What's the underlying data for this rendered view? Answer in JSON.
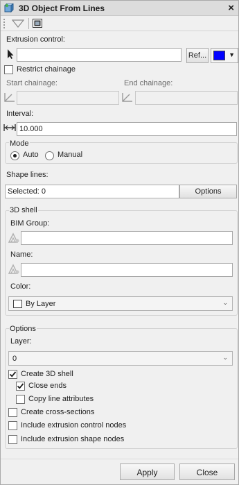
{
  "window": {
    "title": "3D Object From Lines",
    "close_glyph": "×"
  },
  "extrusion": {
    "label": "Extrusion control:",
    "value": "",
    "ref_button": "Ref...",
    "color": "#0000ff",
    "dropdown_glyph": "▼"
  },
  "restrict": {
    "label": "Restrict chainage",
    "checked": false
  },
  "chainage": {
    "start_label": "Start chainage:",
    "end_label": "End chainage:",
    "start_value": "",
    "end_value": ""
  },
  "interval": {
    "label": "Interval:",
    "value": "10.000"
  },
  "mode": {
    "label": "Mode",
    "options": [
      "Auto",
      "Manual"
    ],
    "selected": "Auto"
  },
  "shape_lines": {
    "label": "Shape lines:",
    "value": "Selected: 0",
    "options_button": "Options"
  },
  "shell": {
    "group_label": "3D shell",
    "bim_label": "BIM Group:",
    "bim_value": "",
    "name_label": "Name:",
    "name_value": "",
    "color_label": "Color:",
    "color_value": "By Layer",
    "dropdown_glyph": "⌄"
  },
  "options": {
    "group_label": "Options",
    "layer_label": "Layer:",
    "layer_value": "0",
    "dropdown_glyph": "⌄",
    "checks": [
      {
        "label": "Create 3D shell",
        "checked": true
      },
      {
        "label": "Close ends",
        "checked": true
      },
      {
        "label": "Copy line attributes",
        "checked": false
      },
      {
        "label": "Create cross-sections",
        "checked": false
      },
      {
        "label": "Include extrusion control nodes",
        "checked": false
      },
      {
        "label": "Include extrusion shape nodes",
        "checked": false
      }
    ]
  },
  "footer": {
    "apply": "Apply",
    "close": "Close"
  }
}
